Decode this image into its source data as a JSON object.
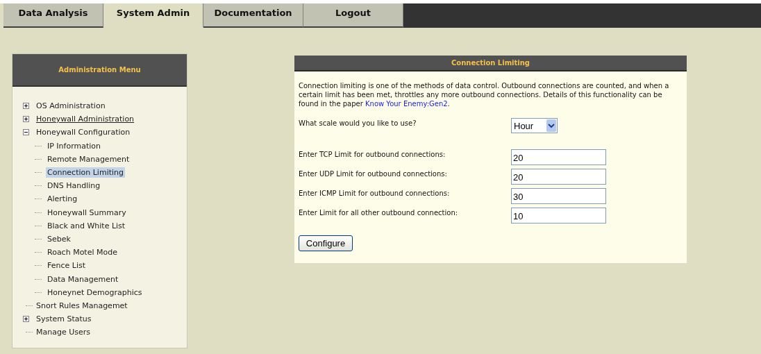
{
  "tabs": [
    {
      "label": "Data Analysis",
      "selected": false
    },
    {
      "label": "System Admin",
      "selected": true
    },
    {
      "label": "Documentation",
      "selected": false
    },
    {
      "label": "Logout",
      "selected": false
    }
  ],
  "sidebar": {
    "title": "Administration Menu",
    "items": [
      {
        "label": "OS Administration",
        "kind": "collapsed",
        "hovered": false,
        "selected": false
      },
      {
        "label": "Honeywall Administration",
        "kind": "collapsed",
        "hovered": true,
        "selected": false
      },
      {
        "label": "Honeywall Configuration",
        "kind": "expanded",
        "hovered": false,
        "selected": false,
        "children": [
          {
            "label": "IP Information",
            "selected": false
          },
          {
            "label": "Remote Management",
            "selected": false
          },
          {
            "label": "Connection Limiting",
            "selected": true
          },
          {
            "label": "DNS Handling",
            "selected": false
          },
          {
            "label": "Alerting",
            "selected": false
          },
          {
            "label": "Honeywall Summary",
            "selected": false
          },
          {
            "label": "Black and White List",
            "selected": false
          },
          {
            "label": "Sebek",
            "selected": false
          },
          {
            "label": "Roach Motel Mode",
            "selected": false
          },
          {
            "label": "Fence List",
            "selected": false
          },
          {
            "label": "Data Management",
            "selected": false
          },
          {
            "label": "Honeynet Demographics",
            "selected": false
          }
        ]
      },
      {
        "label": "Snort Rules Managemet",
        "kind": "leaf",
        "hovered": false,
        "selected": false
      },
      {
        "label": "System Status",
        "kind": "collapsed",
        "hovered": false,
        "selected": false
      },
      {
        "label": "Manage Users",
        "kind": "leaf",
        "hovered": false,
        "selected": false
      }
    ]
  },
  "panel": {
    "title": "Connection Limiting",
    "intro": "Connection limiting is one of the methods of data control. Outbound connections are counted, and when a certain limit has been met, throttles any more outbound connections. Details of this functionality can be found in the paper",
    "link": "Know Your Enemy:Gen2",
    "intro_end": ".",
    "scale": {
      "label": "What scale would you like to use?",
      "value": "Hour"
    },
    "fields": [
      {
        "label": "Enter TCP Limit for outbound connections:",
        "value": "20"
      },
      {
        "label": "Enter UDP Limit for outbound connections:",
        "value": "20"
      },
      {
        "label": "Enter ICMP Limit for outbound connections:",
        "value": "30"
      },
      {
        "label": "Enter Limit for all other outbound connection:",
        "value": "10"
      }
    ],
    "button": "Configure"
  }
}
